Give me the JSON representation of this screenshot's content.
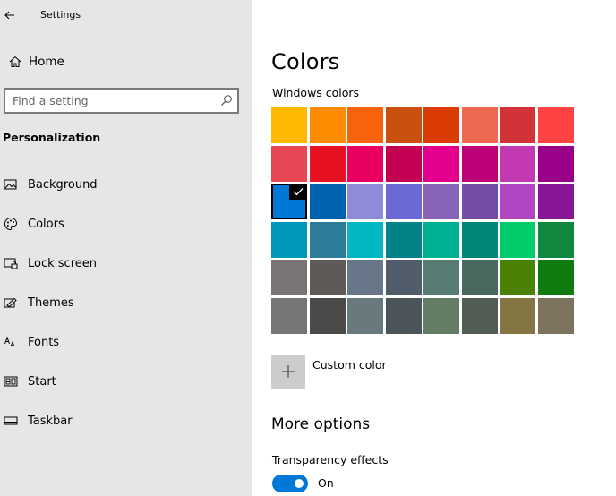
{
  "window": {
    "title": "Settings"
  },
  "sidebar": {
    "home_label": "Home",
    "search_placeholder": "Find a setting",
    "section_header": "Personalization",
    "items": [
      {
        "label": "Background",
        "icon": "picture-icon"
      },
      {
        "label": "Colors",
        "icon": "palette-icon"
      },
      {
        "label": "Lock screen",
        "icon": "lock-screen-icon"
      },
      {
        "label": "Themes",
        "icon": "themes-icon"
      },
      {
        "label": "Fonts",
        "icon": "fonts-icon"
      },
      {
        "label": "Start",
        "icon": "start-icon"
      },
      {
        "label": "Taskbar",
        "icon": "taskbar-icon"
      }
    ]
  },
  "main": {
    "title": "Colors",
    "windows_colors_label": "Windows colors",
    "swatches": [
      "#FFB900",
      "#FF8C00",
      "#F7630C",
      "#CA5010",
      "#DA3B01",
      "#EF6950",
      "#D13438",
      "#FF4343",
      "#E74856",
      "#E81123",
      "#EA005E",
      "#C30052",
      "#E3008C",
      "#BF0077",
      "#C239B3",
      "#9A0089",
      "#0078D7",
      "#0063B1",
      "#8E8CD8",
      "#6B69D6",
      "#8764B8",
      "#744DA9",
      "#B146C2",
      "#881798",
      "#0099BC",
      "#2D7D9A",
      "#00B7C3",
      "#038387",
      "#00B294",
      "#018574",
      "#00CC6A",
      "#10893E",
      "#7A7574",
      "#5D5A58",
      "#68768A",
      "#515C6B",
      "#567C73",
      "#486860",
      "#498205",
      "#107C10",
      "#767676",
      "#4C4A48",
      "#69797E",
      "#4A5459",
      "#647C64",
      "#525E54",
      "#847545",
      "#7E735F"
    ],
    "selected_swatch_index": 16,
    "custom_color_label": "Custom color",
    "more_options_label": "More options",
    "transparency_label": "Transparency effects",
    "transparency_state": "On",
    "accent_color": "#0078D7"
  }
}
